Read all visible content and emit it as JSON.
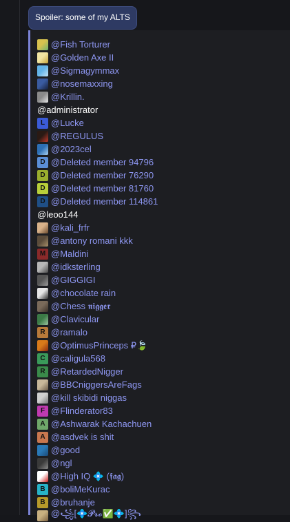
{
  "spoiler": {
    "label": "Spoiler: some of my ALTS"
  },
  "members": [
    {
      "text": "@Fish Torturer",
      "type": "mention",
      "avatar": {
        "kind": "image",
        "colors": [
          "#d8c24f",
          "#6fb36f"
        ]
      }
    },
    {
      "text": "@Golden Axe II",
      "type": "mention",
      "avatar": {
        "kind": "image",
        "colors": [
          "#f2e5a3",
          "#c6a43a"
        ]
      }
    },
    {
      "text": "@Sigmagymmax",
      "type": "mention",
      "avatar": {
        "kind": "image",
        "colors": [
          "#62b3e8",
          "#c4e4f6"
        ]
      }
    },
    {
      "text": "@nosemaxxing",
      "type": "mention",
      "avatar": {
        "kind": "image",
        "colors": [
          "#3a5ba0",
          "#151f3a"
        ]
      }
    },
    {
      "text": "@Krillin.",
      "type": "mention",
      "avatar": {
        "kind": "image",
        "colors": [
          "#8a8a8a",
          "#e6e6e6"
        ]
      }
    },
    {
      "text": "@administrator",
      "type": "plain"
    },
    {
      "text": "@Lucke",
      "type": "mention",
      "avatar": {
        "kind": "letter",
        "letter": "L",
        "color": "#3b5bd6"
      }
    },
    {
      "text": "@REGULUS",
      "type": "mention",
      "avatar": {
        "kind": "image",
        "colors": [
          "#2a1a14",
          "#c0392b"
        ]
      }
    },
    {
      "text": "@2023cel",
      "type": "mention",
      "avatar": {
        "kind": "image",
        "colors": [
          "#2d6fb5",
          "#a7d1f2"
        ]
      }
    },
    {
      "text": "@Deleted member 94796",
      "type": "mention",
      "avatar": {
        "kind": "letter",
        "letter": "D",
        "color": "#5b8ed6"
      }
    },
    {
      "text": "@Deleted member 76290",
      "type": "mention",
      "avatar": {
        "kind": "letter",
        "letter": "D",
        "color": "#9aae2e"
      }
    },
    {
      "text": "@Deleted member 81760",
      "type": "mention",
      "avatar": {
        "kind": "letter",
        "letter": "D",
        "color": "#b8cf3a"
      }
    },
    {
      "text": "@Deleted member 114861",
      "type": "mention",
      "avatar": {
        "kind": "letter",
        "letter": "D",
        "color": "#1f4f86"
      }
    },
    {
      "text": "@leoo144",
      "type": "plain"
    },
    {
      "text": "@kali_frfr",
      "type": "mention",
      "avatar": {
        "kind": "image",
        "colors": [
          "#d9b28a",
          "#6b4a2d"
        ]
      }
    },
    {
      "text": "@antony romani kkk",
      "type": "mention",
      "avatar": {
        "kind": "image",
        "colors": [
          "#5a4b3a",
          "#a8906a"
        ]
      }
    },
    {
      "text": "@Maldini",
      "type": "mention",
      "avatar": {
        "kind": "letter",
        "letter": "M",
        "color": "#8a2a2a"
      }
    },
    {
      "text": "@idksterling",
      "type": "mention",
      "avatar": {
        "kind": "image",
        "colors": [
          "#b7b7b7",
          "#4a4a4a"
        ]
      }
    },
    {
      "text": "@GIGGIGI",
      "type": "mention",
      "avatar": {
        "kind": "image",
        "colors": [
          "#555555",
          "#9a9a9a"
        ]
      }
    },
    {
      "text": "@chocolate rain",
      "type": "mention",
      "avatar": {
        "kind": "image",
        "colors": [
          "#e6e6e6",
          "#303030"
        ]
      }
    },
    {
      "text": "@Chess 𝖓𝖎𝖌𝖌𝖊𝖗",
      "type": "mention",
      "avatar": {
        "kind": "image",
        "colors": [
          "#7a6a5a",
          "#3a3028"
        ]
      }
    },
    {
      "text": "@Clavicular",
      "type": "mention",
      "avatar": {
        "kind": "image",
        "colors": [
          "#3b7a46",
          "#9bc4a0"
        ]
      }
    },
    {
      "text": "@ramalo",
      "type": "mention",
      "avatar": {
        "kind": "letter",
        "letter": "R",
        "color": "#b77a3a"
      }
    },
    {
      "text": "@OptimusPrinceps ₽🍃",
      "type": "mention",
      "avatar": {
        "kind": "image",
        "colors": [
          "#d87a1a",
          "#8a2a10"
        ]
      }
    },
    {
      "text": "@caligula568",
      "type": "mention",
      "avatar": {
        "kind": "letter",
        "letter": "C",
        "color": "#3a9a5a"
      }
    },
    {
      "text": "@RetardedNigger",
      "type": "mention",
      "avatar": {
        "kind": "letter",
        "letter": "R",
        "color": "#3a8a4a"
      }
    },
    {
      "text": "@BBCniggersAreFags",
      "type": "mention",
      "avatar": {
        "kind": "image",
        "colors": [
          "#c8b89a",
          "#6a5a48"
        ]
      }
    },
    {
      "text": "@kill skibidi niggas",
      "type": "mention",
      "avatar": {
        "kind": "image",
        "colors": [
          "#d0d0d0",
          "#7a7a7a"
        ]
      }
    },
    {
      "text": "@Flinderator83",
      "type": "mention",
      "avatar": {
        "kind": "letter",
        "letter": "F",
        "color": "#c03ab0"
      }
    },
    {
      "text": "@Ashwarak Kachachuen",
      "type": "mention",
      "avatar": {
        "kind": "letter",
        "letter": "A",
        "color": "#6fa86a"
      }
    },
    {
      "text": "@asdvek is shit",
      "type": "mention",
      "avatar": {
        "kind": "letter",
        "letter": "A",
        "color": "#c8774f"
      }
    },
    {
      "text": "@good",
      "type": "mention",
      "avatar": {
        "kind": "image",
        "colors": [
          "#2a7ab8",
          "#1a4a78"
        ]
      }
    },
    {
      "text": "@ngl",
      "type": "mention",
      "avatar": {
        "kind": "image",
        "colors": [
          "#3a3a3a",
          "#8a8a8a"
        ]
      }
    },
    {
      "text": "@High IQ 💠 (𝖋𝖆𝖌)",
      "type": "mention",
      "avatar": {
        "kind": "image",
        "colors": [
          "#ffffff",
          "#d02020"
        ]
      }
    },
    {
      "text": "@boliMeKurac",
      "type": "mention",
      "avatar": {
        "kind": "letter",
        "letter": "B",
        "color": "#27b3c8"
      }
    },
    {
      "text": "@bruhanje",
      "type": "mention",
      "avatar": {
        "kind": "letter",
        "letter": "B",
        "color": "#b89a2a"
      }
    },
    {
      "text": "@꧁[💠𝓟𝓻𝓸✅💠]꧂",
      "type": "mention",
      "avatar": {
        "kind": "image",
        "colors": [
          "#c8b080",
          "#7a6040"
        ]
      }
    }
  ]
}
